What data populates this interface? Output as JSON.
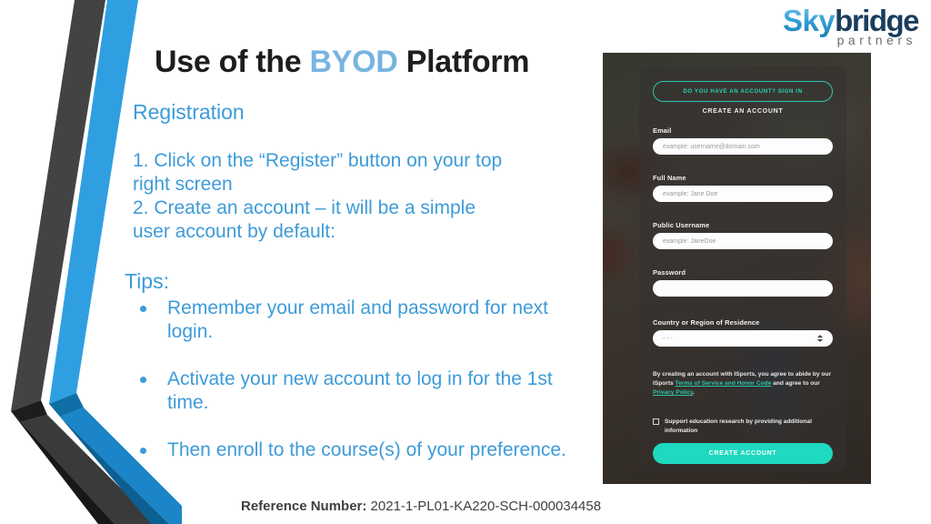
{
  "logo": {
    "word_one": "Sky",
    "word_two": "bridge",
    "tagline": "partners"
  },
  "title": {
    "before": "Use of the ",
    "accent": "BYOD",
    "after": " Platform"
  },
  "content": {
    "section_heading": "Registration",
    "step_1_line_1": "1. Click on the “Register” button on your top",
    "step_1_line_2": "right screen",
    "step_2_line_1": "2. Create an account – it will be a simple",
    "step_2_line_2": "user account by default:",
    "tips_heading": "Tips:",
    "tips": [
      "Remember your email and password for next login.",
      "Activate your new account to log in for the 1st time.",
      "Then enroll to the course(s) of your preference."
    ]
  },
  "footer": {
    "ref_label": "Reference Number:",
    "ref_value": " 2021-1-PL01-KA220-SCH-000034458"
  },
  "screenshot": {
    "sign_in_button": "DO YOU HAVE AN ACCOUNT? SIGN IN",
    "create_heading": "CREATE AN ACCOUNT",
    "fields": [
      {
        "label": "Email",
        "placeholder": "example: username@domain.com"
      },
      {
        "label": "Full Name",
        "placeholder": "example: Jane Doe"
      },
      {
        "label": "Public Username",
        "placeholder": "example: JaneDoe"
      },
      {
        "label": "Password",
        "placeholder": ""
      },
      {
        "label": "Country or Region of Residence",
        "placeholder": "- - -"
      }
    ],
    "terms_part_1": "By creating an account with ISports, you agree to abide by our ISports ",
    "terms_link_1": "Terms of Service and Honor Code",
    "terms_part_2": " and agree to our ",
    "terms_link_2": "Privacy Policy",
    "terms_part_3": ".",
    "consent_label": "Support education research by providing additional information",
    "create_button": "CREATE ACCOUNT"
  },
  "colors": {
    "accent_blue": "#3d9bd9",
    "title_accent": "#77b4e0",
    "deco_dark": "#3f3f3f",
    "deco_blue": "#2b9ae0",
    "form_teal": "#1fd9c0"
  }
}
